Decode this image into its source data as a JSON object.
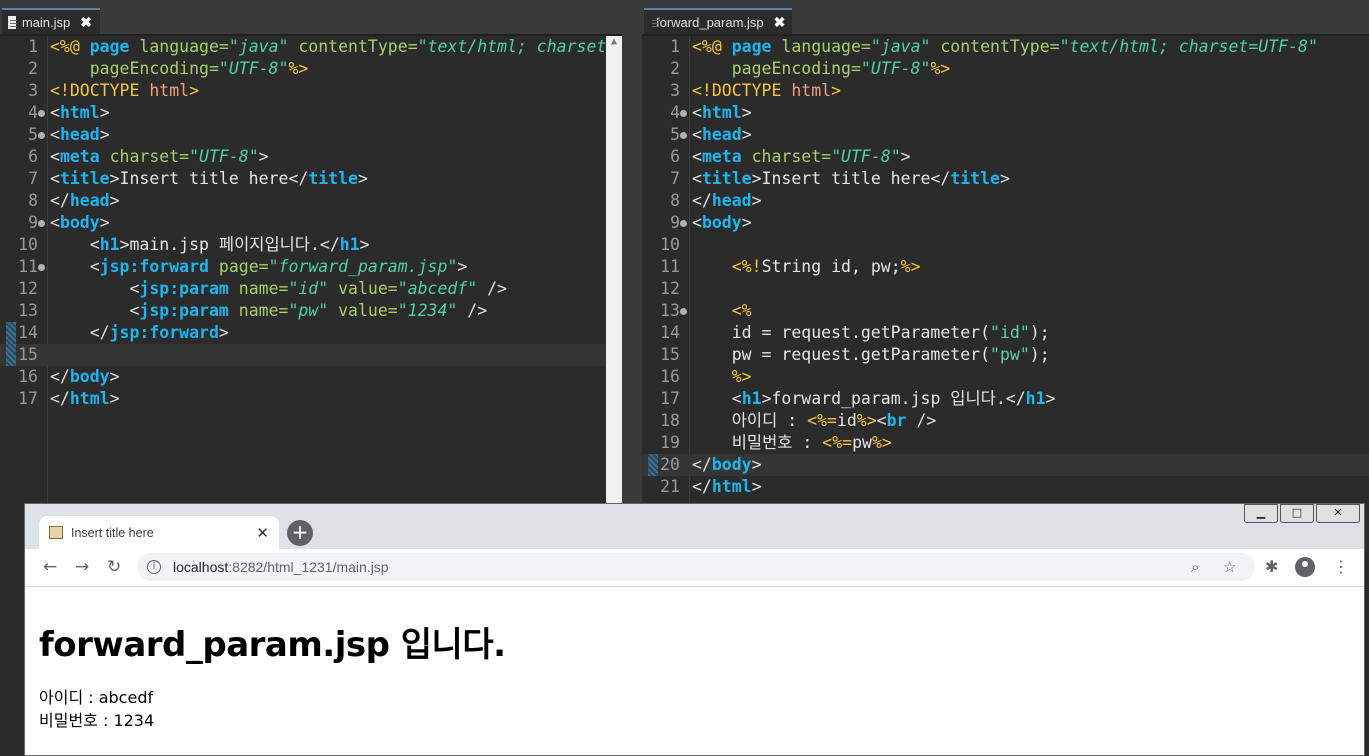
{
  "left_editor": {
    "tab_label": "main.jsp",
    "close_glyph": "✖",
    "lines": [
      {
        "n": "1",
        "fold": false,
        "tokens": [
          [
            "d",
            "<%@ "
          ],
          [
            "t",
            "page "
          ],
          [
            "a",
            "language="
          ],
          [
            "s",
            "\"java\" "
          ],
          [
            "a",
            "contentType="
          ],
          [
            "s",
            "\"text/html; charset"
          ]
        ]
      },
      {
        "n": "2",
        "fold": false,
        "tokens": [
          [
            "p",
            "    "
          ],
          [
            "a",
            "pageEncoding="
          ],
          [
            "s",
            "\"UTF-8\""
          ],
          [
            "d",
            "%>"
          ]
        ]
      },
      {
        "n": "3",
        "fold": false,
        "tokens": [
          [
            "d",
            "<!DOCTYPE "
          ],
          [
            "dt",
            "html"
          ],
          [
            "d",
            ">"
          ]
        ]
      },
      {
        "n": "4",
        "fold": true,
        "tokens": [
          [
            "b",
            "<"
          ],
          [
            "t",
            "html"
          ],
          [
            "b",
            ">"
          ]
        ]
      },
      {
        "n": "5",
        "fold": true,
        "tokens": [
          [
            "b",
            "<"
          ],
          [
            "t",
            "head"
          ],
          [
            "b",
            ">"
          ]
        ]
      },
      {
        "n": "6",
        "fold": false,
        "tokens": [
          [
            "b",
            "<"
          ],
          [
            "t",
            "meta "
          ],
          [
            "a",
            "charset="
          ],
          [
            "s",
            "\"UTF-8\""
          ],
          [
            "b",
            ">"
          ]
        ]
      },
      {
        "n": "7",
        "fold": false,
        "tokens": [
          [
            "b",
            "<"
          ],
          [
            "t",
            "title"
          ],
          [
            "b",
            ">"
          ],
          [
            "p",
            "Insert title here"
          ],
          [
            "b",
            "</"
          ],
          [
            "t",
            "title"
          ],
          [
            "b",
            ">"
          ]
        ]
      },
      {
        "n": "8",
        "fold": false,
        "tokens": [
          [
            "b",
            "</"
          ],
          [
            "t",
            "head"
          ],
          [
            "b",
            ">"
          ]
        ]
      },
      {
        "n": "9",
        "fold": true,
        "tokens": [
          [
            "b",
            "<"
          ],
          [
            "t",
            "body"
          ],
          [
            "b",
            ">"
          ]
        ]
      },
      {
        "n": "10",
        "fold": false,
        "tokens": [
          [
            "p",
            "    "
          ],
          [
            "b",
            "<"
          ],
          [
            "t",
            "h1"
          ],
          [
            "b",
            ">"
          ],
          [
            "p",
            "main.jsp 페이지입니다."
          ],
          [
            "b",
            "</"
          ],
          [
            "t",
            "h1"
          ],
          [
            "b",
            ">"
          ]
        ]
      },
      {
        "n": "11",
        "fold": true,
        "tokens": [
          [
            "p",
            "    "
          ],
          [
            "b",
            "<"
          ],
          [
            "t",
            "jsp:forward "
          ],
          [
            "a",
            "page="
          ],
          [
            "s",
            "\"forward_param.jsp\""
          ],
          [
            "b",
            ">"
          ]
        ]
      },
      {
        "n": "12",
        "fold": false,
        "tokens": [
          [
            "p",
            "        "
          ],
          [
            "b",
            "<"
          ],
          [
            "t",
            "jsp:param "
          ],
          [
            "a",
            "name="
          ],
          [
            "s",
            "\"id\" "
          ],
          [
            "a",
            "value="
          ],
          [
            "s",
            "\"abcedf\" "
          ],
          [
            "b",
            "/>"
          ]
        ]
      },
      {
        "n": "13",
        "fold": false,
        "tokens": [
          [
            "p",
            "        "
          ],
          [
            "b",
            "<"
          ],
          [
            "t",
            "jsp:param "
          ],
          [
            "a",
            "name="
          ],
          [
            "s",
            "\"pw\" "
          ],
          [
            "a",
            "value="
          ],
          [
            "s",
            "\"1234\" "
          ],
          [
            "b",
            "/>"
          ]
        ]
      },
      {
        "n": "14",
        "fold": false,
        "mark": true,
        "tokens": [
          [
            "p",
            "    "
          ],
          [
            "b",
            "</"
          ],
          [
            "t",
            "jsp:forward"
          ],
          [
            "b",
            ">"
          ]
        ]
      },
      {
        "n": "15",
        "fold": false,
        "mark": true,
        "current": true,
        "tokens": []
      },
      {
        "n": "16",
        "fold": false,
        "tokens": [
          [
            "b",
            "</"
          ],
          [
            "t",
            "body"
          ],
          [
            "b",
            ">"
          ]
        ]
      },
      {
        "n": "17",
        "fold": false,
        "tokens": [
          [
            "b",
            "</"
          ],
          [
            "t",
            "html"
          ],
          [
            "b",
            ">"
          ]
        ]
      }
    ]
  },
  "right_editor": {
    "tab_label": "forward_param.jsp",
    "close_glyph": "✖",
    "lines": [
      {
        "n": "1",
        "fold": false,
        "tokens": [
          [
            "d",
            "<%@ "
          ],
          [
            "t",
            "page "
          ],
          [
            "a",
            "language="
          ],
          [
            "s",
            "\"java\" "
          ],
          [
            "a",
            "contentType="
          ],
          [
            "s",
            "\"text/html; charset=UTF-8\""
          ]
        ]
      },
      {
        "n": "2",
        "fold": false,
        "tokens": [
          [
            "p",
            "    "
          ],
          [
            "a",
            "pageEncoding="
          ],
          [
            "s",
            "\"UTF-8\""
          ],
          [
            "d",
            "%>"
          ]
        ]
      },
      {
        "n": "3",
        "fold": false,
        "tokens": [
          [
            "d",
            "<!DOCTYPE "
          ],
          [
            "dt",
            "html"
          ],
          [
            "d",
            ">"
          ]
        ]
      },
      {
        "n": "4",
        "fold": true,
        "tokens": [
          [
            "b",
            "<"
          ],
          [
            "t",
            "html"
          ],
          [
            "b",
            ">"
          ]
        ]
      },
      {
        "n": "5",
        "fold": true,
        "tokens": [
          [
            "b",
            "<"
          ],
          [
            "t",
            "head"
          ],
          [
            "b",
            ">"
          ]
        ]
      },
      {
        "n": "6",
        "fold": false,
        "tokens": [
          [
            "b",
            "<"
          ],
          [
            "t",
            "meta "
          ],
          [
            "a",
            "charset="
          ],
          [
            "s",
            "\"UTF-8\""
          ],
          [
            "b",
            ">"
          ]
        ]
      },
      {
        "n": "7",
        "fold": false,
        "tokens": [
          [
            "b",
            "<"
          ],
          [
            "t",
            "title"
          ],
          [
            "b",
            ">"
          ],
          [
            "p",
            "Insert title here"
          ],
          [
            "b",
            "</"
          ],
          [
            "t",
            "title"
          ],
          [
            "b",
            ">"
          ]
        ]
      },
      {
        "n": "8",
        "fold": false,
        "tokens": [
          [
            "b",
            "</"
          ],
          [
            "t",
            "head"
          ],
          [
            "b",
            ">"
          ]
        ]
      },
      {
        "n": "9",
        "fold": true,
        "tokens": [
          [
            "b",
            "<"
          ],
          [
            "t",
            "body"
          ],
          [
            "b",
            ">"
          ]
        ]
      },
      {
        "n": "10",
        "fold": false,
        "tokens": []
      },
      {
        "n": "11",
        "fold": false,
        "tokens": [
          [
            "p",
            "    "
          ],
          [
            "d",
            "<%!"
          ],
          [
            "p",
            "String id, pw;"
          ],
          [
            "d",
            "%>"
          ]
        ]
      },
      {
        "n": "12",
        "fold": false,
        "tokens": []
      },
      {
        "n": "13",
        "fold": true,
        "tokens": [
          [
            "p",
            "    "
          ],
          [
            "d",
            "<%"
          ]
        ]
      },
      {
        "n": "14",
        "fold": false,
        "tokens": [
          [
            "p",
            "    id = request.getParameter("
          ],
          [
            "j",
            "\"id\""
          ],
          [
            "p",
            ");"
          ]
        ]
      },
      {
        "n": "15",
        "fold": false,
        "tokens": [
          [
            "p",
            "    pw = request.getParameter("
          ],
          [
            "j",
            "\"pw\""
          ],
          [
            "p",
            ");"
          ]
        ]
      },
      {
        "n": "16",
        "fold": false,
        "tokens": [
          [
            "p",
            "    "
          ],
          [
            "d",
            "%>"
          ]
        ]
      },
      {
        "n": "17",
        "fold": false,
        "tokens": [
          [
            "p",
            "    "
          ],
          [
            "b",
            "<"
          ],
          [
            "t",
            "h1"
          ],
          [
            "b",
            ">"
          ],
          [
            "p",
            "forward_param.jsp 입니다."
          ],
          [
            "b",
            "</"
          ],
          [
            "t",
            "h1"
          ],
          [
            "b",
            ">"
          ]
        ]
      },
      {
        "n": "18",
        "fold": false,
        "tokens": [
          [
            "p",
            "    아이디 : "
          ],
          [
            "d",
            "<%="
          ],
          [
            "p",
            "id"
          ],
          [
            "d",
            "%>"
          ],
          [
            "b",
            "<"
          ],
          [
            "t",
            "br "
          ],
          [
            "b",
            "/>"
          ]
        ]
      },
      {
        "n": "19",
        "fold": false,
        "tokens": [
          [
            "p",
            "    비밀번호 : "
          ],
          [
            "d",
            "<%="
          ],
          [
            "p",
            "pw"
          ],
          [
            "d",
            "%>"
          ]
        ]
      },
      {
        "n": "20",
        "fold": false,
        "mark": true,
        "current": true,
        "tokens": [
          [
            "b",
            "</"
          ],
          [
            "t",
            "body"
          ],
          [
            "b",
            ">"
          ]
        ]
      },
      {
        "n": "21",
        "fold": false,
        "tokens": [
          [
            "b",
            "</"
          ],
          [
            "t",
            "html"
          ],
          [
            "b",
            ">"
          ]
        ]
      }
    ]
  },
  "browser": {
    "tab_title": "Insert title here",
    "tab_close": "✕",
    "new_tab": "+",
    "window_buttons": {
      "minimize": "▁",
      "maximize": "□",
      "close": "✕"
    },
    "url_host": "localhost",
    "url_rest": ":8282/html_1231/main.jsp",
    "page": {
      "heading": "forward_param.jsp 입니다.",
      "id_line": "아이디 : abcedf",
      "pw_line": "비밀번호 : 1234"
    }
  },
  "icons": [
    "file-icon",
    "close-icon",
    "back-icon",
    "forward-icon",
    "reload-icon",
    "info-icon",
    "zoom-icon",
    "star-icon",
    "extensions-icon",
    "profile-icon",
    "menu-icon"
  ]
}
